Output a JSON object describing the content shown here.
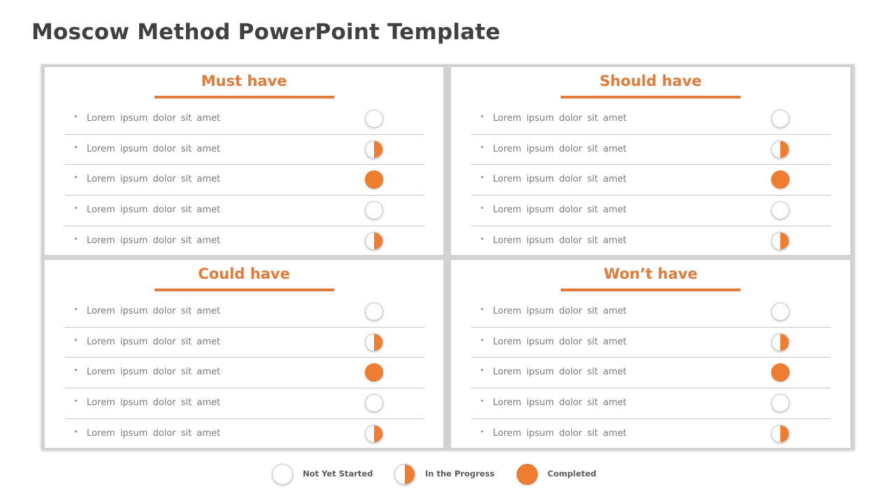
{
  "title": "Moscow Method PowerPoint Template",
  "accent_color": "#ee7d31",
  "panels": [
    {
      "heading": "Must have",
      "items": [
        {
          "text": "Lorem  ipsum  dolor  sit amet",
          "status": "not-started"
        },
        {
          "text": "Lorem  ipsum  dolor  sit amet",
          "status": "in-progress"
        },
        {
          "text": "Lorem  ipsum  dolor  sit amet",
          "status": "completed"
        },
        {
          "text": "Lorem  ipsum  dolor  sit amet",
          "status": "not-started"
        },
        {
          "text": "Lorem  ipsum  dolor  sit amet",
          "status": "in-progress"
        }
      ]
    },
    {
      "heading": "Should have",
      "items": [
        {
          "text": "Lorem  ipsum  dolor  sit amet",
          "status": "not-started"
        },
        {
          "text": "Lorem  ipsum  dolor  sit amet",
          "status": "in-progress"
        },
        {
          "text": "Lorem  ipsum  dolor  sit amet",
          "status": "completed"
        },
        {
          "text": "Lorem  ipsum  dolor  sit amet",
          "status": "not-started"
        },
        {
          "text": "Lorem  ipsum  dolor  sit amet",
          "status": "in-progress"
        }
      ]
    },
    {
      "heading": "Could have",
      "items": [
        {
          "text": "Lorem  ipsum  dolor  sit amet",
          "status": "not-started"
        },
        {
          "text": "Lorem  ipsum  dolor  sit amet",
          "status": "in-progress"
        },
        {
          "text": "Lorem  ipsum  dolor  sit amet",
          "status": "completed"
        },
        {
          "text": "Lorem  ipsum  dolor  sit amet",
          "status": "not-started"
        },
        {
          "text": "Lorem  ipsum  dolor  sit amet",
          "status": "in-progress"
        }
      ]
    },
    {
      "heading": "Won’t have",
      "items": [
        {
          "text": "Lorem  ipsum  dolor  sit amet",
          "status": "not-started"
        },
        {
          "text": "Lorem  ipsum  dolor  sit amet",
          "status": "in-progress"
        },
        {
          "text": "Lorem  ipsum  dolor  sit amet",
          "status": "completed"
        },
        {
          "text": "Lorem  ipsum  dolor  sit amet",
          "status": "not-started"
        },
        {
          "text": "Lorem  ipsum  dolor  sit amet",
          "status": "in-progress"
        }
      ]
    }
  ],
  "legend": [
    {
      "label": "Not Yet Started",
      "status": "not-started"
    },
    {
      "label": "In the Progress",
      "status": "in-progress"
    },
    {
      "label": "Completed",
      "status": "completed"
    }
  ]
}
